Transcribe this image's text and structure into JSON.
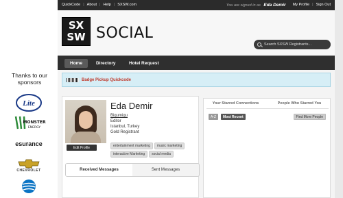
{
  "sponsors": {
    "title": "Thanks to our sponsors",
    "logos": [
      {
        "name": "Lite",
        "color": "#1b3a87"
      },
      {
        "name": "Monster Energy",
        "color": "#111111"
      },
      {
        "name": "esurance",
        "color": "#1a1a1a"
      },
      {
        "name": "CHEVROLET",
        "color": "#c9a227"
      },
      {
        "name": "AT&T",
        "color": "#0b74c4"
      }
    ]
  },
  "topbar": {
    "nav": [
      "QuickCode",
      "About",
      "Help",
      "SXSW.com"
    ],
    "signed_in_text": "You are signed in as",
    "user": "Eda Demir",
    "right": [
      "My Profile",
      "Sign Out"
    ]
  },
  "header": {
    "logo_letters": [
      "SX",
      "SW"
    ],
    "title": "SOCIAL",
    "search_placeholder": "Search SXSW Registrants..."
  },
  "navbar": {
    "tabs": [
      "Home",
      "Directory",
      "Hotel Request"
    ],
    "active": "Home"
  },
  "alert": {
    "text": "Badge Pickup Quickcode"
  },
  "profile": {
    "name": "Eda Demir",
    "username": "Bigumigu",
    "role": "Editor",
    "location": "Istanbul, Turkey",
    "registrant": "Gold Registrant",
    "edit_label": "Edit Profile",
    "tags": [
      "entertainment marketing",
      "music marketing",
      "interactive Marketing",
      "social media"
    ]
  },
  "messages": {
    "tabs": [
      "Received Messages",
      "Sent Messages"
    ],
    "active": "Received Messages"
  },
  "connections": {
    "tabs": [
      "Your Starred Connections",
      "People Who Starred You"
    ],
    "sort_az": "A-Z",
    "sort_recent": "Most Recent",
    "find_more": "Find More People"
  }
}
